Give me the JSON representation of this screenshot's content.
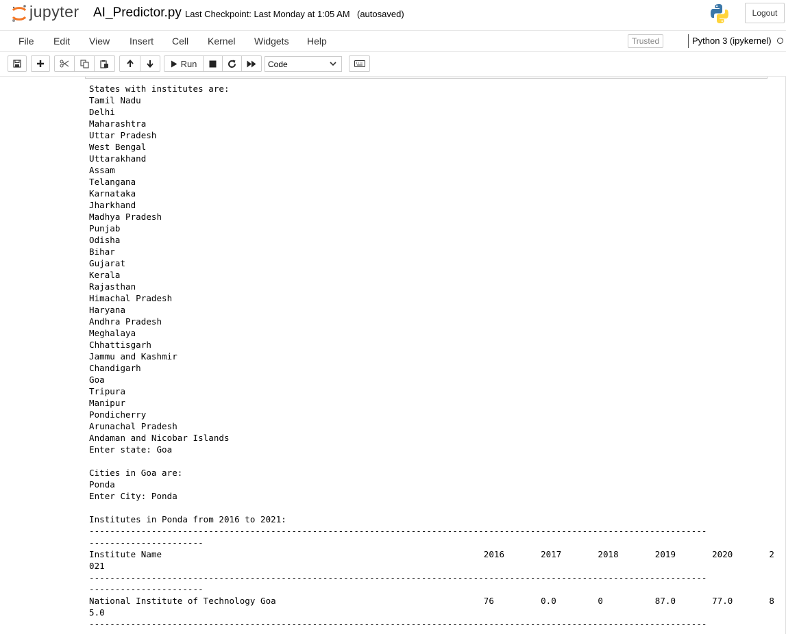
{
  "header": {
    "logo_text": "jupyter",
    "notebook_name": "AI_Predictor.py",
    "checkpoint": "Last Checkpoint: Last Monday at 1:05 AM",
    "autosave_status": "(autosaved)",
    "logout_label": "Logout",
    "icons": [
      "jupyter-logo-icon",
      "python-logo-icon"
    ]
  },
  "menubar": {
    "items": [
      "File",
      "Edit",
      "View",
      "Insert",
      "Cell",
      "Kernel",
      "Widgets",
      "Help"
    ],
    "trusted_label": "Trusted",
    "kernel_name": "Python 3 (ipykernel)",
    "kernel_status_icon": "kernel-idle-icon"
  },
  "toolbar": {
    "buttons": [
      "save-icon",
      "plus-icon",
      "cut-icon",
      "copy-icon",
      "paste-icon",
      "arrow-up-icon",
      "arrow-down-icon",
      "run-icon",
      "stop-icon",
      "restart-icon",
      "fast-forward-icon",
      "keyboard-icon"
    ],
    "run_label": "Run",
    "cell_type": "Code"
  },
  "output": {
    "lines": [
      "States with institutes are:",
      "Tamil Nadu",
      "Delhi",
      "Maharashtra",
      "Uttar Pradesh",
      "West Bengal",
      "Uttarakhand",
      "Assam",
      "Telangana",
      "Karnataka",
      "Jharkhand",
      "Madhya Pradesh",
      "Punjab",
      "Odisha",
      "Bihar",
      "Gujarat",
      "Kerala",
      "Rajasthan",
      "Himachal Pradesh",
      "Haryana",
      "Andhra Pradesh",
      "Meghalaya",
      "Chhattisgarh",
      "Jammu and Kashmir",
      "Chandigarh",
      "Goa",
      "Tripura",
      "Manipur",
      "Pondicherry",
      "Arunachal Pradesh",
      "Andaman and Nicobar Islands",
      "Enter state: Goa",
      "",
      "Cities in Goa are:",
      "Ponda",
      "Enter City: Ponda",
      "",
      "Institutes in Ponda from 2016 to 2021:",
      "-----------------------------------------------------------------------------------------------------------------------",
      "----------------------",
      "Institute Name                                                              2016       2017       2018       2019       2020       2",
      "021",
      "-----------------------------------------------------------------------------------------------------------------------",
      "----------------------",
      "National Institute of Technology Goa                                        76         0.0        0          87.0       77.0       8",
      "5.0",
      "-----------------------------------------------------------------------------------------------------------------------"
    ]
  }
}
